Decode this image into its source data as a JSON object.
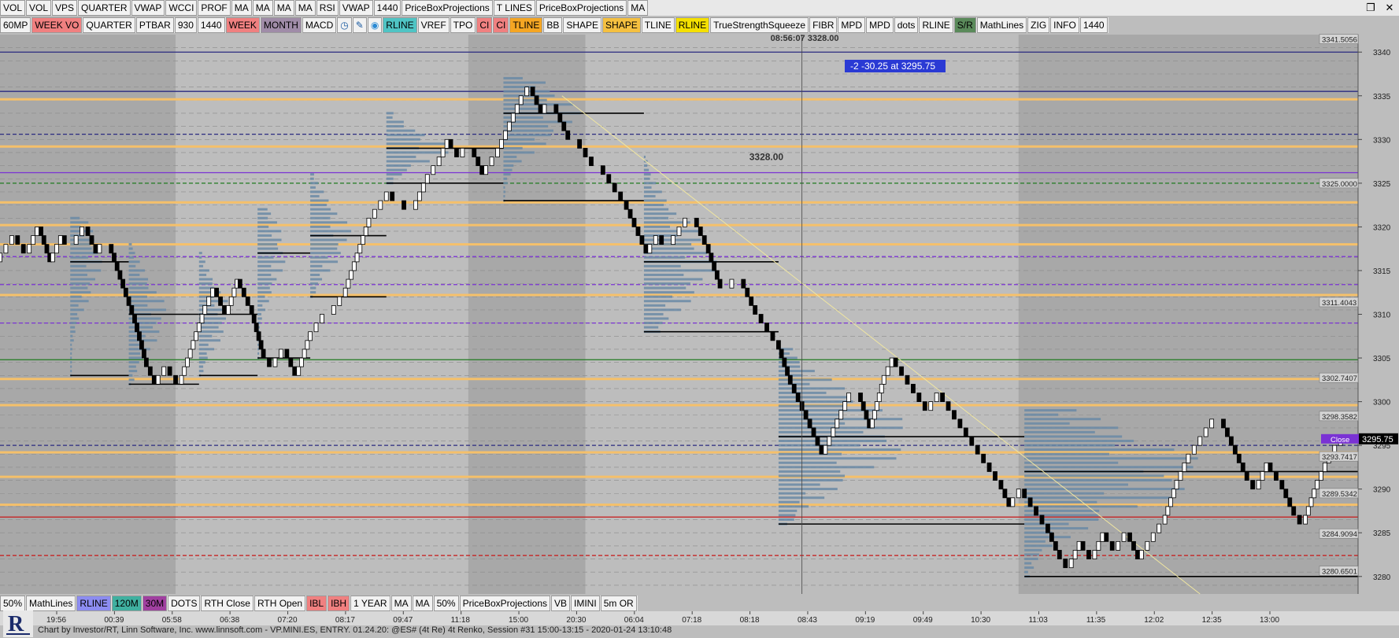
{
  "window": {
    "toolbar_top": [
      "VOL",
      "VOL",
      "VPS",
      "QUARTER",
      "VWAP",
      "WCCI",
      "PROF",
      "MA",
      "MA",
      "MA",
      "MA",
      "RSI",
      "VWAP",
      "1440",
      "PriceBoxProjections",
      "T LINES",
      "PriceBoxProjections",
      "MA"
    ],
    "restore_icon": "restore-icon",
    "close_icon": "close-icon"
  },
  "toolbar_second": [
    {
      "label": "60MP",
      "bg": "#f2f2f2"
    },
    {
      "label": "WEEK VO",
      "bg": "#f08080"
    },
    {
      "label": "QUARTER",
      "bg": "#f2f2f2"
    },
    {
      "label": "PTBAR",
      "bg": "#f2f2f2"
    },
    {
      "label": "930",
      "bg": "#f2f2f2"
    },
    {
      "label": "1440",
      "bg": "#f2f2f2"
    },
    {
      "label": "WEEK",
      "bg": "#f08080"
    },
    {
      "label": "MONTH",
      "bg": "#a08ca8"
    },
    {
      "label": "MACD",
      "bg": "#f2f2f2"
    },
    {
      "label": "clock-icon",
      "bg": "#f2f2f2",
      "icon": true
    },
    {
      "label": "pencil-icon",
      "bg": "#f2f2f2",
      "icon": true
    },
    {
      "label": "drop-icon",
      "bg": "#f2f2f2",
      "icon": true
    },
    {
      "label": "RLINE",
      "bg": "#4fc4c4"
    },
    {
      "label": "VREF",
      "bg": "#f2f2f2"
    },
    {
      "label": "TPO",
      "bg": "#f2f2f2"
    },
    {
      "label": "CI",
      "bg": "#f08080"
    },
    {
      "label": "CI",
      "bg": "#f08080"
    },
    {
      "label": "TLINE",
      "bg": "#f5a623"
    },
    {
      "label": "BB",
      "bg": "#f2f2f2"
    },
    {
      "label": "SHAPE",
      "bg": "#f2f2f2"
    },
    {
      "label": "SHAPE",
      "bg": "#f5c040"
    },
    {
      "label": "TLINE",
      "bg": "#f2f2f2"
    },
    {
      "label": "RLINE",
      "bg": "#f5e000"
    },
    {
      "label": "TrueStrengthSqueeze",
      "bg": "#f2f2f2"
    },
    {
      "label": "FIBR",
      "bg": "#f2f2f2"
    },
    {
      "label": "MPD",
      "bg": "#f2f2f2"
    },
    {
      "label": "MPD",
      "bg": "#f2f2f2"
    },
    {
      "label": "dots",
      "bg": "#f2f2f2"
    },
    {
      "label": "RLINE",
      "bg": "#f2f2f2"
    },
    {
      "label": "S/R",
      "bg": "#5a8a5a"
    },
    {
      "label": "MathLines",
      "bg": "#f2f2f2"
    },
    {
      "label": "ZIG",
      "bg": "#f2f2f2"
    },
    {
      "label": "INFO",
      "bg": "#f2f2f2"
    },
    {
      "label": "1440",
      "bg": "#f2f2f2"
    }
  ],
  "toolbar_bottom": [
    {
      "label": "50%",
      "bg": "#f2f2f2"
    },
    {
      "label": "MathLines",
      "bg": "#f2f2f2"
    },
    {
      "label": "RLINE",
      "bg": "#8c8cf0"
    },
    {
      "label": "120M",
      "bg": "#40b0a0"
    },
    {
      "label": "30M",
      "bg": "#a040a0"
    },
    {
      "label": "DOTS",
      "bg": "#f2f2f2"
    },
    {
      "label": "RTH Close",
      "bg": "#f2f2f2"
    },
    {
      "label": "RTH Open",
      "bg": "#f2f2f2"
    },
    {
      "label": "IBL",
      "bg": "#f08080"
    },
    {
      "label": "IBH",
      "bg": "#f08080"
    },
    {
      "label": "1 YEAR",
      "bg": "#f2f2f2"
    },
    {
      "label": "MA",
      "bg": "#f2f2f2"
    },
    {
      "label": "MA",
      "bg": "#f2f2f2"
    },
    {
      "label": "50%",
      "bg": "#f2f2f2"
    },
    {
      "label": "PriceBoxProjections",
      "bg": "#f2f2f2"
    },
    {
      "label": "VB",
      "bg": "#f2f2f2"
    },
    {
      "label": "IMINI",
      "bg": "#f2f2f2"
    },
    {
      "label": "5m OR",
      "bg": "#f2f2f2"
    }
  ],
  "status_bar": "Chart by Investor/RT, Linn Software, Inc. www.linnsoft.com - VP.MINI.ES, ENTRY.   01.24.20: @ES# (4t Re) 4t Renko, Session #31 15:00-13:15 - 2020-01-24 13:10:48",
  "colors": {
    "background": "#bdbdbd",
    "shade": "#a8a8a8",
    "orange": "#f5c06a",
    "purple": "#7a32d4",
    "navy": "#2a2a80",
    "green": "#1f7a1f",
    "red": "#c81818",
    "profile": "#6a8aa6"
  },
  "chart_data": {
    "type": "renko",
    "instrument": "@ES# (4t Re) 4t Renko",
    "ylim": [
      3278,
      3342
    ],
    "y_ticks": [
      3280,
      3285,
      3290,
      3295,
      3300,
      3305,
      3310,
      3315,
      3320,
      3325,
      3330,
      3335,
      3340
    ],
    "x_tick_labels": [
      "19:56",
      "00:39",
      "05:58",
      "06:38",
      "07:20",
      "08:17",
      "09:47",
      "11:18",
      "15:00",
      "20:30",
      "06:04",
      "07:18",
      "08:18",
      "08:43",
      "09:19",
      "09:49",
      "10:30",
      "11:03",
      "11:35",
      "12:02",
      "12:35",
      "13:00"
    ],
    "crosshair": {
      "time": "08:56:07",
      "price": "3328.00"
    },
    "price_cursor_label": "3328.00",
    "annotation_box": "-2  -30.25 at 3295.75",
    "price_labels": [
      {
        "text": "3341.5056",
        "value": 3341.5
      },
      {
        "text": "3325.0000",
        "value": 3325.0
      },
      {
        "text": "3311.4043",
        "value": 3311.4
      },
      {
        "text": "3302.7407",
        "value": 3302.74
      },
      {
        "text": "3298.3582",
        "value": 3298.36
      },
      {
        "text": "3293.7417",
        "value": 3293.74
      },
      {
        "text": "3289.5342",
        "value": 3289.53
      },
      {
        "text": "3284.9094",
        "value": 3284.91
      },
      {
        "text": "3280.6501",
        "value": 3280.65
      }
    ],
    "last_price": {
      "text": "3295.75",
      "value": 3295.75
    },
    "close_tag": "Close",
    "price_path": [
      [
        0,
        3316
      ],
      [
        3,
        3319
      ],
      [
        5,
        3317
      ],
      [
        7,
        3320
      ],
      [
        9,
        3316
      ],
      [
        11,
        3319
      ],
      [
        13,
        3318
      ],
      [
        15,
        3320
      ],
      [
        17,
        3317
      ],
      [
        19,
        3318
      ],
      [
        21,
        3314
      ],
      [
        23,
        3310
      ],
      [
        25,
        3305
      ],
      [
        27,
        3302
      ],
      [
        29,
        3304
      ],
      [
        31,
        3302
      ],
      [
        33,
        3306
      ],
      [
        35,
        3310
      ],
      [
        37,
        3313
      ],
      [
        39,
        3310
      ],
      [
        41,
        3314
      ],
      [
        43,
        3311
      ],
      [
        45,
        3306
      ],
      [
        47,
        3304
      ],
      [
        49,
        3306
      ],
      [
        51,
        3303
      ],
      [
        53,
        3307
      ],
      [
        55,
        3309
      ],
      [
        57,
        3310
      ],
      [
        59,
        3312
      ],
      [
        61,
        3316
      ],
      [
        63,
        3320
      ],
      [
        65,
        3322
      ],
      [
        67,
        3324
      ],
      [
        69,
        3323
      ],
      [
        71,
        3322
      ],
      [
        73,
        3325
      ],
      [
        75,
        3327
      ],
      [
        77,
        3330
      ],
      [
        79,
        3328
      ],
      [
        81,
        3329
      ],
      [
        83,
        3326
      ],
      [
        85,
        3328
      ],
      [
        87,
        3331
      ],
      [
        89,
        3334
      ],
      [
        91,
        3336
      ],
      [
        93,
        3333
      ],
      [
        95,
        3334
      ],
      [
        97,
        3331
      ],
      [
        99,
        3330
      ],
      [
        101,
        3328
      ],
      [
        103,
        3327
      ],
      [
        105,
        3325
      ],
      [
        107,
        3323
      ],
      [
        109,
        3320
      ],
      [
        111,
        3317
      ],
      [
        113,
        3319
      ],
      [
        115,
        3318
      ],
      [
        117,
        3320
      ],
      [
        119,
        3321
      ],
      [
        121,
        3318
      ],
      [
        123,
        3314
      ],
      [
        125,
        3313
      ],
      [
        127,
        3314
      ],
      [
        129,
        3311
      ],
      [
        131,
        3309
      ],
      [
        133,
        3307
      ],
      [
        135,
        3303
      ],
      [
        137,
        3300
      ],
      [
        139,
        3297
      ],
      [
        141,
        3294
      ],
      [
        143,
        3297
      ],
      [
        145,
        3300
      ],
      [
        147,
        3301
      ],
      [
        149,
        3297
      ],
      [
        151,
        3302
      ],
      [
        153,
        3305
      ],
      [
        155,
        3303
      ],
      [
        157,
        3301
      ],
      [
        159,
        3299
      ],
      [
        161,
        3301
      ],
      [
        163,
        3299
      ],
      [
        165,
        3297
      ],
      [
        167,
        3295
      ],
      [
        169,
        3293
      ],
      [
        171,
        3291
      ],
      [
        173,
        3288
      ],
      [
        175,
        3290
      ],
      [
        177,
        3288
      ],
      [
        179,
        3286
      ],
      [
        181,
        3283
      ],
      [
        183,
        3281
      ],
      [
        185,
        3284
      ],
      [
        187,
        3282
      ],
      [
        189,
        3285
      ],
      [
        191,
        3283
      ],
      [
        193,
        3285
      ],
      [
        195,
        3282
      ],
      [
        197,
        3284
      ],
      [
        199,
        3286
      ],
      [
        201,
        3290
      ],
      [
        203,
        3293
      ],
      [
        205,
        3295
      ],
      [
        207,
        3297
      ],
      [
        209,
        3298
      ],
      [
        211,
        3295
      ],
      [
        213,
        3292
      ],
      [
        215,
        3290
      ],
      [
        217,
        3293
      ],
      [
        219,
        3291
      ],
      [
        221,
        3288
      ],
      [
        223,
        3286
      ],
      [
        225,
        3290
      ],
      [
        227,
        3293
      ],
      [
        229,
        3295
      ],
      [
        231,
        3296
      ]
    ],
    "levels": [
      {
        "value": 3340.0,
        "color": "navy",
        "style": "solid"
      },
      {
        "value": 3335.5,
        "color": "navy",
        "style": "solid"
      },
      {
        "value": 3334.6,
        "color": "orange",
        "style": "solid"
      },
      {
        "value": 3330.6,
        "color": "navy",
        "style": "dashed"
      },
      {
        "value": 3329.2,
        "color": "orange",
        "style": "solid"
      },
      {
        "value": 3326.2,
        "color": "purple",
        "style": "solid"
      },
      {
        "value": 3325.0,
        "color": "green",
        "style": "dashed"
      },
      {
        "value": 3322.8,
        "color": "orange",
        "style": "solid"
      },
      {
        "value": 3320.2,
        "color": "orange",
        "style": "solid"
      },
      {
        "value": 3318.0,
        "color": "orange",
        "style": "solid"
      },
      {
        "value": 3316.6,
        "color": "purple",
        "style": "dashed"
      },
      {
        "value": 3313.4,
        "color": "purple",
        "style": "dashed"
      },
      {
        "value": 3312.2,
        "color": "orange",
        "style": "solid"
      },
      {
        "value": 3309.0,
        "color": "purple",
        "style": "dashed"
      },
      {
        "value": 3304.8,
        "color": "green",
        "style": "solid"
      },
      {
        "value": 3302.6,
        "color": "orange",
        "style": "solid"
      },
      {
        "value": 3299.6,
        "color": "orange",
        "style": "solid"
      },
      {
        "value": 3295.0,
        "color": "navy",
        "style": "dashed"
      },
      {
        "value": 3294.2,
        "color": "orange",
        "style": "solid"
      },
      {
        "value": 3291.4,
        "color": "orange",
        "style": "solid"
      },
      {
        "value": 3288.2,
        "color": "orange",
        "style": "solid"
      },
      {
        "value": 3286.8,
        "color": "red",
        "style": "solid"
      },
      {
        "value": 3282.4,
        "color": "red",
        "style": "dashed"
      }
    ],
    "volume_profiles": [
      {
        "start": 12,
        "end": 22,
        "low": 3303,
        "high": 3321,
        "poc": 3316
      },
      {
        "start": 22,
        "end": 34,
        "low": 3302,
        "high": 3318,
        "poc": 3310
      },
      {
        "start": 34,
        "end": 44,
        "low": 3303,
        "high": 3317,
        "poc": 3310
      },
      {
        "start": 44,
        "end": 53,
        "low": 3305,
        "high": 3322,
        "poc": 3317
      },
      {
        "start": 53,
        "end": 66,
        "low": 3312,
        "high": 3326,
        "poc": 3319
      },
      {
        "start": 66,
        "end": 86,
        "low": 3325,
        "high": 3333,
        "poc": 3329
      },
      {
        "start": 86,
        "end": 110,
        "low": 3323,
        "high": 3337,
        "poc": 3333
      },
      {
        "start": 110,
        "end": 133,
        "low": 3308,
        "high": 3328,
        "poc": 3316
      },
      {
        "start": 133,
        "end": 175,
        "low": 3286,
        "high": 3306,
        "poc": 3296
      },
      {
        "start": 175,
        "end": 232,
        "low": 3280,
        "high": 3299,
        "poc": 3292
      }
    ],
    "trend_line": {
      "from": [
        96,
        3335
      ],
      "to": [
        205,
        3278
      ]
    }
  }
}
